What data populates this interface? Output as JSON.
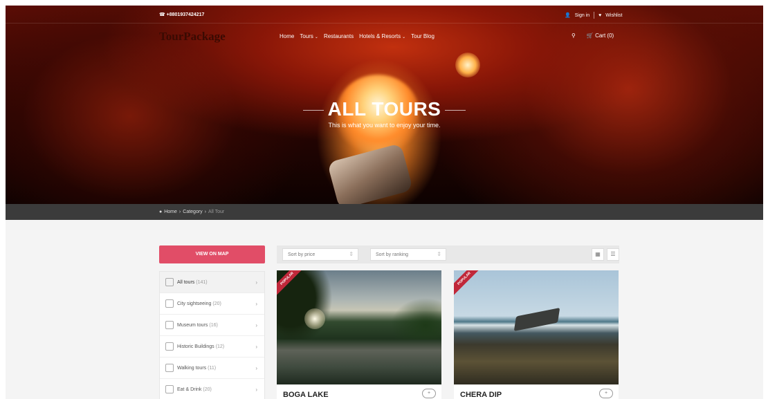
{
  "topbar": {
    "phone": "☎ +8801937424217",
    "sign_in": "Sign in",
    "wishlist": "Wishlist"
  },
  "logo": "TourPackage",
  "nav": {
    "items": [
      "Home",
      "Tours",
      "Restaurants",
      "Hotels & Resorts",
      "Tour Blog"
    ],
    "cart": "Cart (0)"
  },
  "hero": {
    "title": "ALL TOURS",
    "subtitle": "This is what you want to enjoy your time."
  },
  "breadcrumb": {
    "home": "Home",
    "category": "Category",
    "current": "All Tour"
  },
  "sidebar": {
    "map_button": "VIEW ON MAP",
    "filters": [
      {
        "label": "All tours",
        "count": "(141)"
      },
      {
        "label": "City sightseeing",
        "count": "(20)"
      },
      {
        "label": "Museum tours",
        "count": "(16)"
      },
      {
        "label": "Historic Buildings",
        "count": "(12)"
      },
      {
        "label": "Walking tours",
        "count": "(11)"
      },
      {
        "label": "Eat & Drink",
        "count": "(20)"
      }
    ]
  },
  "toolbar": {
    "sort_price": "Sort by price",
    "sort_ranking": "Sort by ranking"
  },
  "cards": [
    {
      "name": "BOGA LAKE",
      "badge": "POPULAR"
    },
    {
      "name": "CHERA DIP",
      "badge": "POPULAR"
    }
  ],
  "icons": {
    "phone": "phone-icon",
    "user": "user-icon",
    "heart": "heart-icon",
    "search": "search-icon",
    "cart": "cart-icon",
    "home": "home-icon",
    "grid": "grid-view-icon",
    "list": "list-view-icon"
  },
  "colors": {
    "accent": "#e14d67",
    "ribbon": "#c0283a",
    "breadcrumb_bg": "#3b3b3b"
  }
}
